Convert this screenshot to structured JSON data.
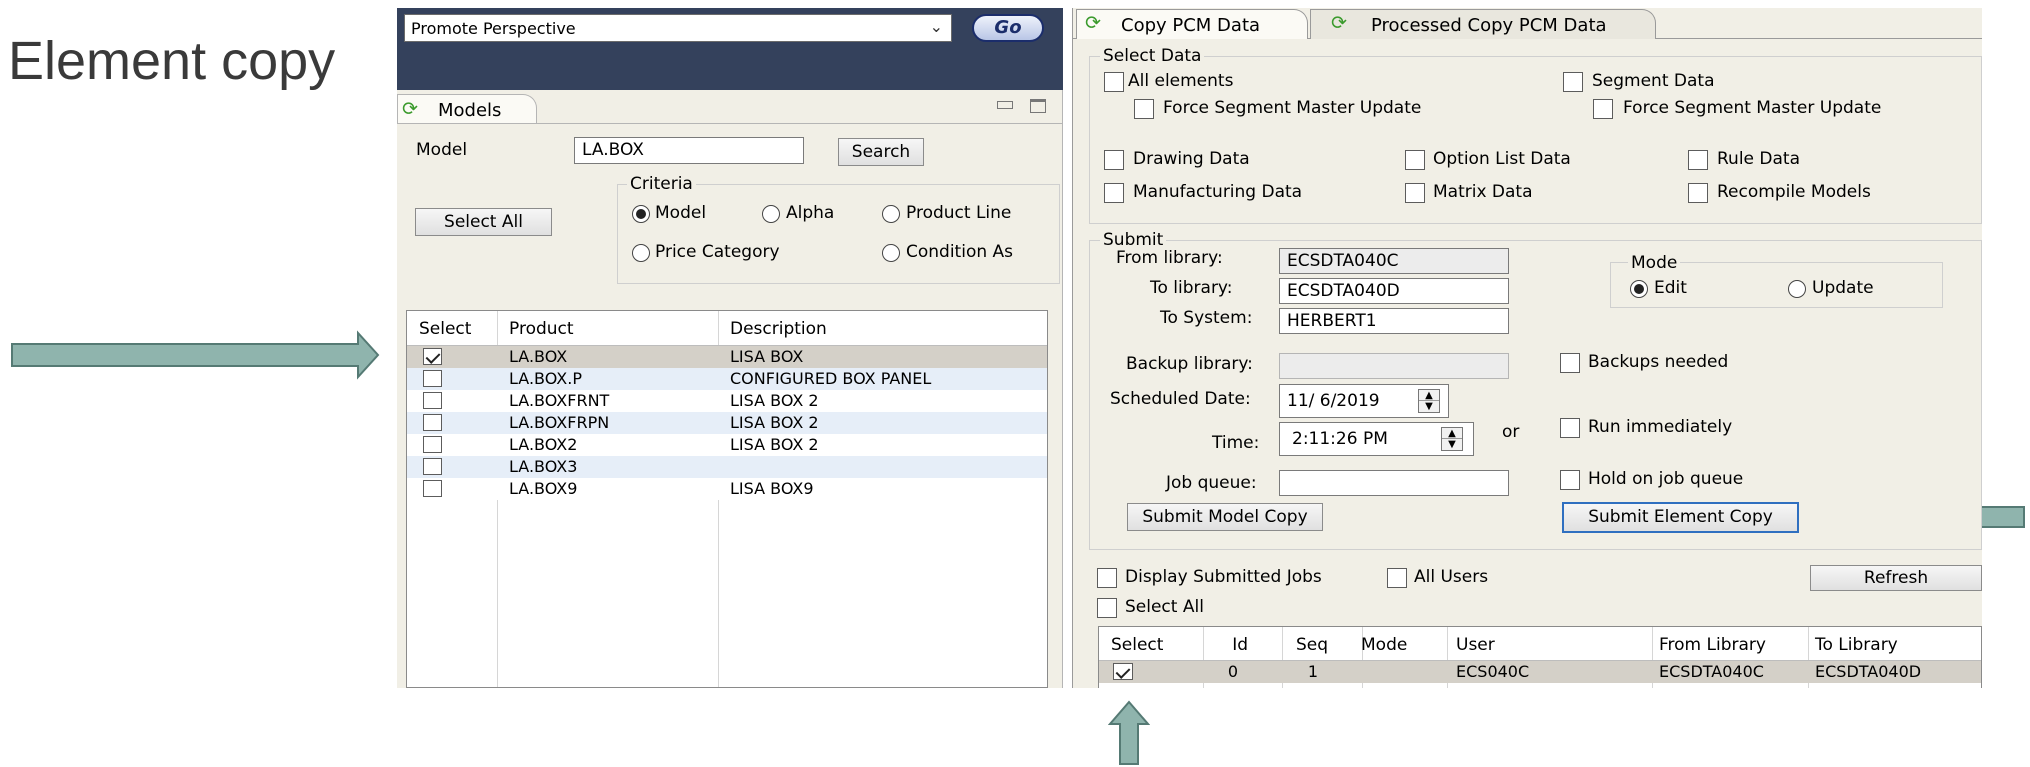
{
  "slide_title": "Element copy",
  "top_bar": {
    "perspective": "Promote Perspective",
    "go_label": "Go"
  },
  "models_panel": {
    "tab_label": "Models",
    "model_label": "Model",
    "model_value": "LA.BOX",
    "search_label": "Search",
    "select_all_label": "Select All",
    "criteria_title": "Criteria",
    "criteria_options": [
      "Model",
      "Alpha",
      "Product Line",
      "Price Category",
      "Condition As"
    ],
    "criteria_selected": "Model",
    "table": {
      "headers": [
        "Select",
        "Product",
        "Description"
      ],
      "rows": [
        {
          "checked": true,
          "product": "LA.BOX",
          "description": "LISA BOX"
        },
        {
          "checked": false,
          "product": "LA.BOX.P",
          "description": "CONFIGURED BOX PANEL"
        },
        {
          "checked": false,
          "product": "LA.BOXFRNT",
          "description": "LISA BOX 2"
        },
        {
          "checked": false,
          "product": "LA.BOXFRPN",
          "description": "LISA BOX 2"
        },
        {
          "checked": false,
          "product": "LA.BOX2",
          "description": "LISA BOX 2"
        },
        {
          "checked": false,
          "product": "LA.BOX3",
          "description": ""
        },
        {
          "checked": false,
          "product": "LA.BOX9",
          "description": "LISA BOX9"
        }
      ]
    }
  },
  "copy_panel": {
    "tabs": [
      "Copy PCM Data",
      "Processed Copy PCM Data"
    ],
    "select_data": {
      "title": "Select Data",
      "all_elements": "All elements",
      "force_segment_master_update": "Force Segment Master Update",
      "segment_data": "Segment Data",
      "force_segment_master_update_2": "Force Segment Master Update",
      "drawing_data": "Drawing Data",
      "option_list_data": "Option List Data",
      "rule_data": "Rule Data",
      "manufacturing_data": "Manufacturing Data",
      "matrix_data": "Matrix Data",
      "recompile_models": "Recompile Models"
    },
    "submit": {
      "title": "Submit",
      "from_library_label": "From library:",
      "from_library_value": "ECSDTA040C",
      "to_library_label": "To library:",
      "to_library_value": "ECSDTA040D",
      "to_system_label": "To System:",
      "to_system_value": "HERBERT1",
      "mode_title": "Mode",
      "mode_edit": "Edit",
      "mode_update": "Update",
      "backup_library_label": "Backup library:",
      "backups_needed": "Backups needed",
      "scheduled_date_label": "Scheduled Date:",
      "scheduled_date_value": "11/ 6/2019",
      "time_label": "Time:",
      "time_value": "2:11:26 PM",
      "or_label": "or",
      "run_immediately": "Run immediately",
      "job_queue_label": "Job queue:",
      "job_queue_value": "",
      "hold_on_job_queue": "Hold on job queue",
      "submit_model_copy": "Submit Model Copy",
      "submit_element_copy": "Submit Element Copy"
    },
    "jobs": {
      "display_submitted_jobs": "Display Submitted Jobs",
      "all_users": "All Users",
      "refresh": "Refresh",
      "select_all": "Select All",
      "headers": [
        "Select",
        "Id",
        "Seq",
        "Mode",
        "User",
        "From Library",
        "To Library"
      ],
      "rows": [
        {
          "checked": true,
          "id": "0",
          "seq": "1",
          "mode": "",
          "user": "ECS040C",
          "from_library": "ECSDTA040C",
          "to_library": "ECSDTA040D"
        }
      ]
    }
  },
  "colors": {
    "arrow": "#8fb4ad",
    "arrow_border": "#557a74",
    "panel_bg": "#f1efe6",
    "dark_bar": "#34415c",
    "highlight_row": "#d4d0c8"
  }
}
